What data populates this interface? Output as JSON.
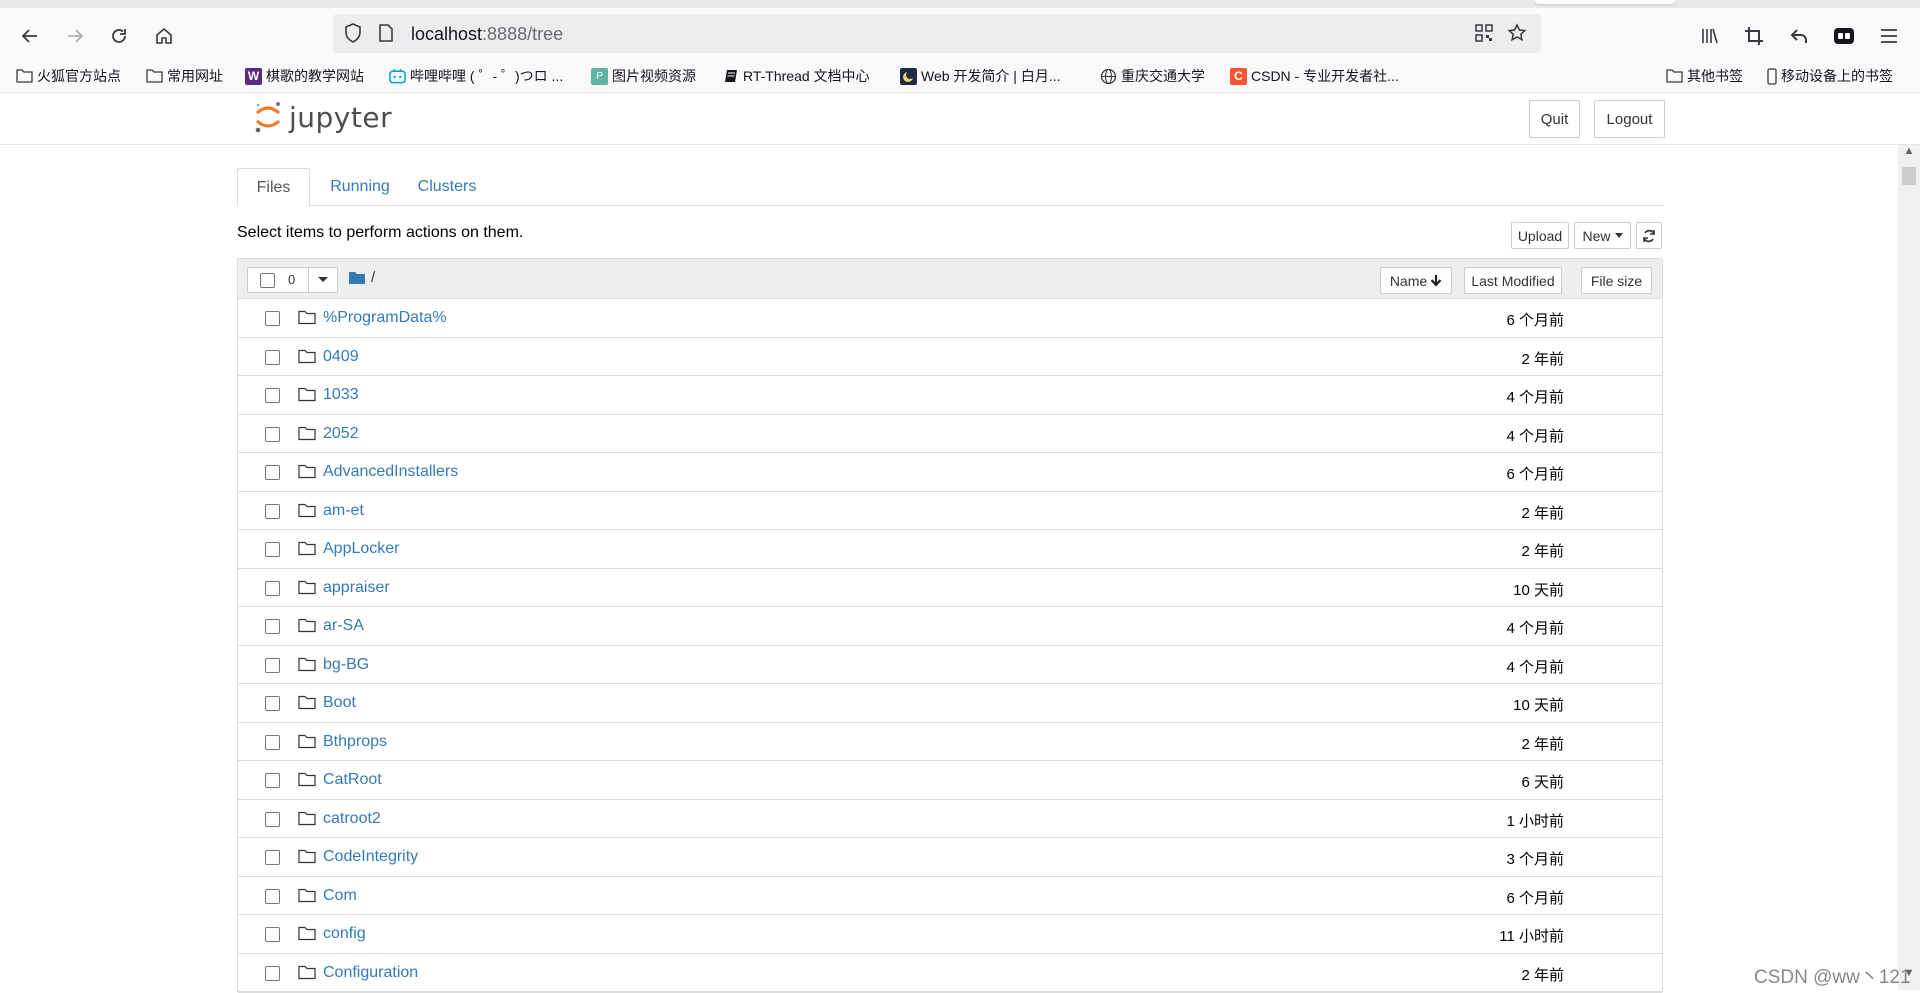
{
  "browser": {
    "url_host": "localhost",
    "url_rest": ":8888/tree",
    "bookmarks": [
      {
        "label": "火狐官方站点",
        "icon": "folder-icon"
      },
      {
        "label": "常用网址",
        "icon": "folder-icon"
      },
      {
        "label": "棋歌的教学网站",
        "icon": "w-logo-icon"
      },
      {
        "label": "哔哩哔哩 ( ゜- ゜)つロ ...",
        "icon": "bilibili-icon"
      },
      {
        "label": "图片视频资源",
        "icon": "image-site-icon"
      },
      {
        "label": "RT-Thread 文档中心",
        "icon": "doc-icon"
      },
      {
        "label": "Web 开发简介 | 白月...",
        "icon": "moon-icon"
      },
      {
        "label": "重庆交通大学",
        "icon": "globe-icon"
      },
      {
        "label": "CSDN - 专业开发者社...",
        "icon": "csdn-icon"
      },
      {
        "label": "其他书签",
        "icon": "folder-icon"
      },
      {
        "label": "移动设备上的书签",
        "icon": "mobile-icon"
      }
    ]
  },
  "header": {
    "logo_text": "jupyter",
    "quit_label": "Quit",
    "logout_label": "Logout"
  },
  "tabs": [
    {
      "label": "Files",
      "active": true
    },
    {
      "label": "Running",
      "active": false
    },
    {
      "label": "Clusters",
      "active": false
    }
  ],
  "toolbar": {
    "hint": "Select items to perform actions on them.",
    "upload_label": "Upload",
    "new_label": "New"
  },
  "list_header": {
    "selected_count": "0",
    "path": "/",
    "name_label": "Name",
    "modified_label": "Last Modified",
    "size_label": "File size"
  },
  "items": [
    {
      "name": "%ProgramData%",
      "modified": "6 个月前"
    },
    {
      "name": "0409",
      "modified": "2 年前"
    },
    {
      "name": "1033",
      "modified": "4 个月前"
    },
    {
      "name": "2052",
      "modified": "4 个月前"
    },
    {
      "name": "AdvancedInstallers",
      "modified": "6 个月前"
    },
    {
      "name": "am-et",
      "modified": "2 年前"
    },
    {
      "name": "AppLocker",
      "modified": "2 年前"
    },
    {
      "name": "appraiser",
      "modified": "10 天前"
    },
    {
      "name": "ar-SA",
      "modified": "4 个月前"
    },
    {
      "name": "bg-BG",
      "modified": "4 个月前"
    },
    {
      "name": "Boot",
      "modified": "10 天前"
    },
    {
      "name": "Bthprops",
      "modified": "2 年前"
    },
    {
      "name": "CatRoot",
      "modified": "6 天前"
    },
    {
      "name": "catroot2",
      "modified": "1 小时前"
    },
    {
      "name": "CodeIntegrity",
      "modified": "3 个月前"
    },
    {
      "name": "Com",
      "modified": "6 个月前"
    },
    {
      "name": "config",
      "modified": "11 小时前"
    },
    {
      "name": "Configuration",
      "modified": "2 年前"
    }
  ],
  "watermark": "CSDN @ww丶121"
}
